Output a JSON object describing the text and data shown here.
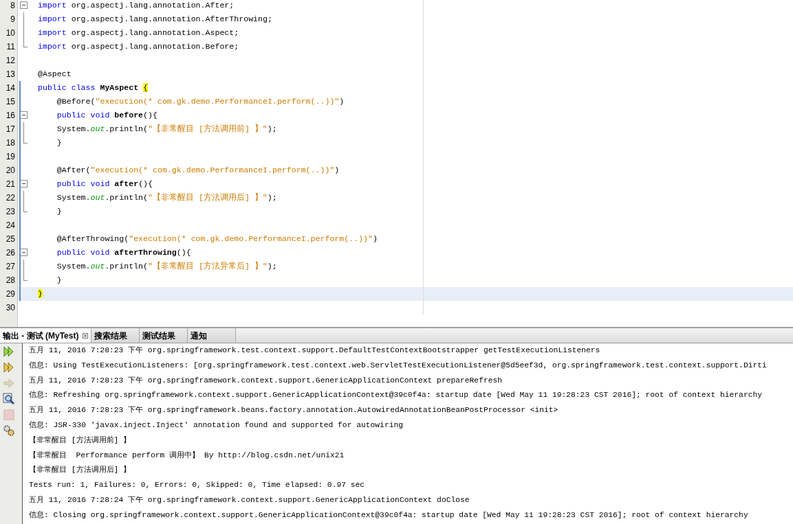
{
  "editor": {
    "lines": [
      {
        "number": "8",
        "kind": "fold-start",
        "scope": false,
        "selected": false,
        "tokens": [
          {
            "kind": "keyword",
            "text": "import"
          },
          {
            "kind": "plain",
            "text": " org.aspectj.lang.annotation.After;"
          }
        ]
      },
      {
        "number": "9",
        "kind": "fold-mid",
        "scope": false,
        "selected": false,
        "tokens": [
          {
            "kind": "keyword",
            "text": "import"
          },
          {
            "kind": "plain",
            "text": " org.aspectj.lang.annotation.AfterThrowing;"
          }
        ]
      },
      {
        "number": "10",
        "kind": "fold-mid",
        "scope": false,
        "selected": false,
        "tokens": [
          {
            "kind": "keyword",
            "text": "import"
          },
          {
            "kind": "plain",
            "text": " org.aspectj.lang.annotation.Aspect;"
          }
        ]
      },
      {
        "number": "11",
        "kind": "fold-end",
        "scope": false,
        "selected": false,
        "tokens": [
          {
            "kind": "keyword",
            "text": "import"
          },
          {
            "kind": "plain",
            "text": " org.aspectj.lang.annotation.Before;"
          }
        ]
      },
      {
        "number": "12",
        "kind": "plain",
        "scope": false,
        "selected": false
      },
      {
        "number": "13",
        "kind": "plain",
        "scope": false,
        "selected": false,
        "tokens": [
          {
            "kind": "plain",
            "text": "@Aspect"
          }
        ]
      },
      {
        "number": "14",
        "kind": "plain",
        "scope": true,
        "selected": false,
        "tokens": [
          {
            "kind": "keyword",
            "text": "public class"
          },
          {
            "kind": "bold",
            "text": " MyAspect "
          },
          {
            "kind": "match",
            "text": "{"
          }
        ]
      },
      {
        "number": "15",
        "kind": "plain",
        "scope": true,
        "selected": false,
        "tokens": [
          {
            "kind": "plain",
            "text": "    @Before("
          },
          {
            "kind": "string",
            "text": "\"execution(* com.gk.demo.PerformanceI.perform(..))\""
          },
          {
            "kind": "plain",
            "text": ")"
          }
        ]
      },
      {
        "number": "16",
        "kind": "fold-start",
        "scope": true,
        "selected": false,
        "tokens": [
          {
            "kind": "keyword",
            "text": "    public void"
          },
          {
            "kind": "bold",
            "text": " before"
          },
          {
            "kind": "plain",
            "text": "(){"
          }
        ]
      },
      {
        "number": "17",
        "kind": "fold-mid",
        "scope": true,
        "selected": false,
        "tokens": [
          {
            "kind": "plain",
            "text": "    System."
          },
          {
            "kind": "field",
            "text": "out"
          },
          {
            "kind": "plain",
            "text": ".println("
          },
          {
            "kind": "string",
            "text": "\"【非常醒目 [方法调用前] 】\""
          },
          {
            "kind": "plain",
            "text": ");"
          }
        ]
      },
      {
        "number": "18",
        "kind": "fold-end",
        "scope": true,
        "selected": false,
        "tokens": [
          {
            "kind": "plain",
            "text": "    }"
          }
        ]
      },
      {
        "number": "19",
        "kind": "plain",
        "scope": true,
        "selected": false
      },
      {
        "number": "20",
        "kind": "plain",
        "scope": true,
        "selected": false,
        "tokens": [
          {
            "kind": "plain",
            "text": "    @After("
          },
          {
            "kind": "string",
            "text": "\"execution(* com.gk.demo.PerformanceI.perform(..))\""
          },
          {
            "kind": "plain",
            "text": ")"
          }
        ]
      },
      {
        "number": "21",
        "kind": "fold-start",
        "scope": true,
        "selected": false,
        "tokens": [
          {
            "kind": "keyword",
            "text": "    public void"
          },
          {
            "kind": "bold",
            "text": " after"
          },
          {
            "kind": "plain",
            "text": "(){"
          }
        ]
      },
      {
        "number": "22",
        "kind": "fold-mid",
        "scope": true,
        "selected": false,
        "tokens": [
          {
            "kind": "plain",
            "text": "    System."
          },
          {
            "kind": "field",
            "text": "out"
          },
          {
            "kind": "plain",
            "text": ".println("
          },
          {
            "kind": "string",
            "text": "\"【非常醒目 [方法调用后] 】\""
          },
          {
            "kind": "plain",
            "text": ");"
          }
        ]
      },
      {
        "number": "23",
        "kind": "fold-end",
        "scope": true,
        "selected": false,
        "tokens": [
          {
            "kind": "plain",
            "text": "    }"
          }
        ]
      },
      {
        "number": "24",
        "kind": "plain",
        "scope": true,
        "selected": false
      },
      {
        "number": "25",
        "kind": "plain",
        "scope": true,
        "selected": false,
        "tokens": [
          {
            "kind": "plain",
            "text": "    @AfterThrowing("
          },
          {
            "kind": "string",
            "text": "\"execution(* com.gk.demo.PerformanceI.perform(..))\""
          },
          {
            "kind": "plain",
            "text": ")"
          }
        ]
      },
      {
        "number": "26",
        "kind": "fold-start",
        "scope": true,
        "selected": false,
        "tokens": [
          {
            "kind": "keyword",
            "text": "    public void"
          },
          {
            "kind": "bold",
            "text": " afterThrowing"
          },
          {
            "kind": "plain",
            "text": "(){"
          }
        ]
      },
      {
        "number": "27",
        "kind": "fold-mid",
        "scope": true,
        "selected": false,
        "tokens": [
          {
            "kind": "plain",
            "text": "    System."
          },
          {
            "kind": "field",
            "text": "out"
          },
          {
            "kind": "plain",
            "text": ".println("
          },
          {
            "kind": "string",
            "text": "\"【非常醒目 [方法异常后] 】\""
          },
          {
            "kind": "plain",
            "text": ");"
          }
        ]
      },
      {
        "number": "28",
        "kind": "fold-end",
        "scope": true,
        "selected": false,
        "tokens": [
          {
            "kind": "plain",
            "text": "    }"
          }
        ]
      },
      {
        "number": "29",
        "kind": "plain",
        "scope": true,
        "selected": true,
        "tokens": [
          {
            "kind": "match",
            "text": "}"
          }
        ]
      },
      {
        "number": "30",
        "kind": "plain",
        "scope": false,
        "selected": false
      }
    ]
  },
  "output_panel": {
    "tabs": [
      {
        "label": "输出 - 测试 (MyTest)",
        "selected": true,
        "closable": true
      },
      {
        "label": "搜索结果",
        "selected": false,
        "closable": false
      },
      {
        "label": "测试结果",
        "selected": false,
        "closable": false
      },
      {
        "label": "通知",
        "selected": false,
        "closable": false
      }
    ],
    "toolbar": [
      {
        "kind": "rerun",
        "disabled": false
      },
      {
        "kind": "rerun-failed",
        "disabled": false
      },
      {
        "kind": "next",
        "disabled": true
      },
      {
        "kind": "find",
        "disabled": false
      },
      {
        "kind": "stop",
        "disabled": true
      },
      {
        "kind": "settings",
        "disabled": false
      }
    ],
    "lines": [
      "五月 11, 2016 7:28:23 下午 org.springframework.test.context.support.DefaultTestContextBootstrapper getTestExecutionListeners",
      "信息: Using TestExecutionListeners: [org.springframework.test.context.web.ServletTestExecutionListener@5d5eef3d, org.springframework.test.context.support.Dirti",
      "五月 11, 2016 7:28:23 下午 org.springframework.context.support.GenericApplicationContext prepareRefresh",
      "信息: Refreshing org.springframework.context.support.GenericApplicationContext@39c0f4a: startup date [Wed May 11 19:28:23 CST 2016]; root of context hierarchy",
      "五月 11, 2016 7:28:23 下午 org.springframework.beans.factory.annotation.AutowiredAnnotationBeanPostProcessor <init>",
      "信息: JSR-330 'javax.inject.Inject' annotation found and supported for autowiring",
      "【非常醒目 [方法调用前] 】",
      "【非常醒目  Performance perform 调用中】 By http://blog.csdn.net/unix21",
      "【非常醒目 [方法调用后] 】",
      "Tests run: 1, Failures: 0, Errors: 0, Skipped: 0, Time elapsed: 0.97 sec",
      "五月 11, 2016 7:28:24 下午 org.springframework.context.support.GenericApplicationContext doClose",
      "信息: Closing org.springframework.context.support.GenericApplicationContext@39c0f4a: startup date [Wed May 11 19:28:23 CST 2016]; root of context hierarchy"
    ]
  }
}
